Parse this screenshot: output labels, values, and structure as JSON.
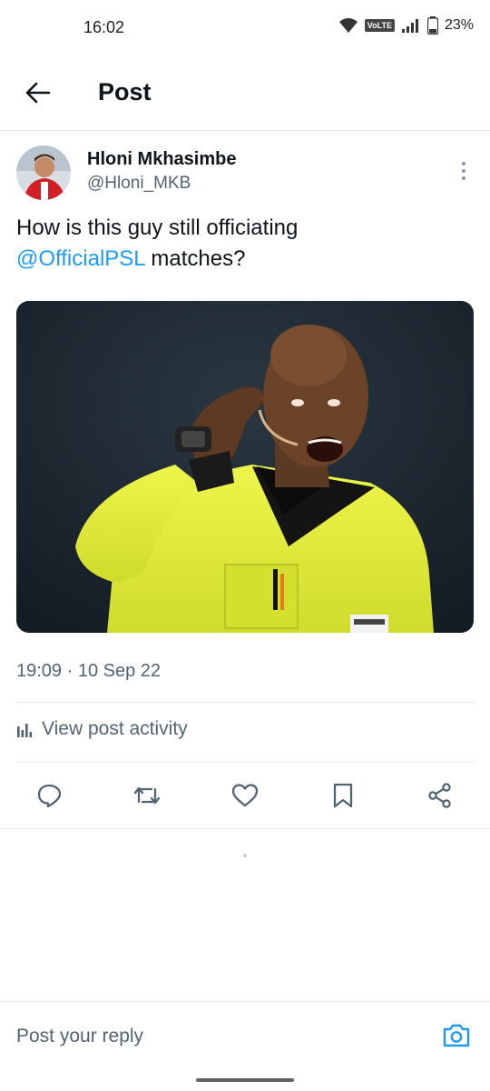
{
  "status_bar": {
    "time": "16:02",
    "network": "VoLTE",
    "battery": "23%"
  },
  "header": {
    "title": "Post",
    "back_icon": "arrow-left-icon"
  },
  "post": {
    "author_name": "Hloni Mkhasimbe",
    "author_handle": "@Hloni_MKB",
    "text_part1": "How is this guy still officiating",
    "mention": "@OfficialPSL",
    "text_part2": " matches?",
    "timestamp": "19:09 · 10 Sep 22",
    "view_activity": "View post activity"
  },
  "actions": [
    {
      "name": "reply",
      "icon": "comment-icon"
    },
    {
      "name": "repost",
      "icon": "repost-icon"
    },
    {
      "name": "like",
      "icon": "heart-icon"
    },
    {
      "name": "bookmark",
      "icon": "bookmark-icon"
    },
    {
      "name": "share",
      "icon": "share-icon"
    }
  ],
  "reply_bar": {
    "placeholder": "Post your reply",
    "camera_icon": "camera-icon"
  },
  "colors": {
    "accent": "#1d9bf0",
    "text_primary": "#0f1419",
    "text_secondary": "#536471",
    "divider": "#e6e6e6",
    "referee_jersey": "#e4f23a"
  }
}
